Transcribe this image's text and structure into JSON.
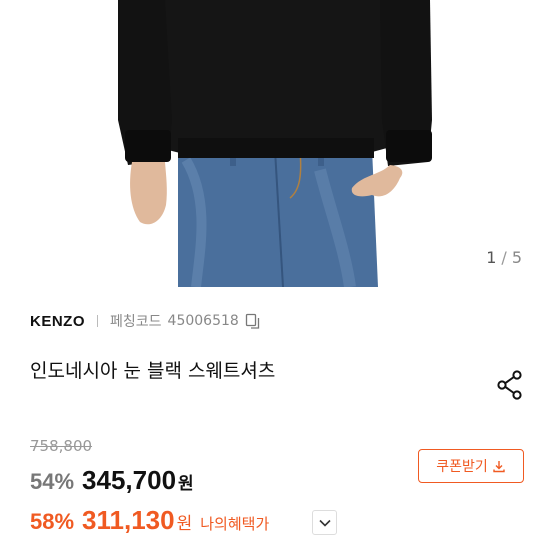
{
  "gallery": {
    "current": "1",
    "separator": "/",
    "total": "5"
  },
  "product": {
    "brand": "KENZO",
    "code_label": "페칭코드",
    "code_value": "45006518",
    "title": "인도네시아 눈 블랙 스웨트셔츠"
  },
  "pricing": {
    "original_price": "758,800",
    "discount_rate": "54%",
    "sale_price": "345,700",
    "currency": "원",
    "my_discount_rate": "58%",
    "my_price": "311,130",
    "my_currency": "원",
    "my_benefit_label": "나의혜택가"
  },
  "coupon": {
    "label": "쿠폰받기"
  },
  "colors": {
    "accent": "#f05a22",
    "sweatshirt": "#141414",
    "denim": "#4a6f9c"
  }
}
